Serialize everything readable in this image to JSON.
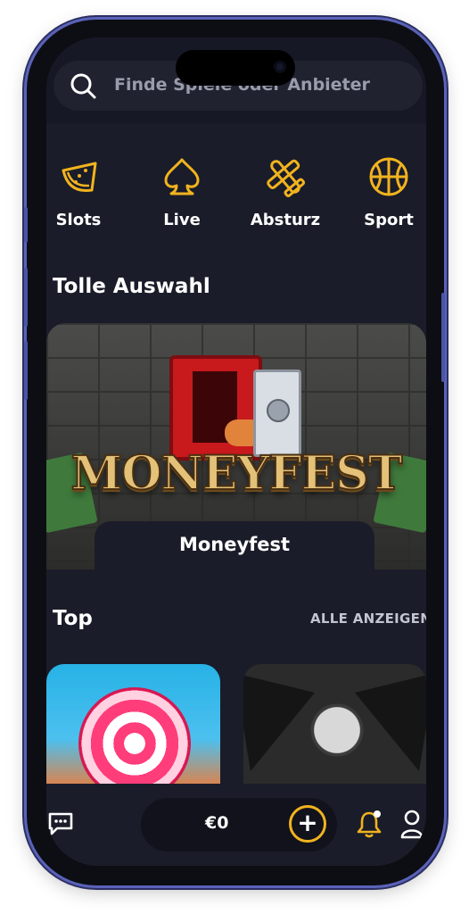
{
  "search": {
    "placeholder": "Finde Spiele oder Anbieter"
  },
  "categories": [
    {
      "label": "Slots",
      "icon": "watermelon-icon"
    },
    {
      "label": "Live",
      "icon": "spade-icon"
    },
    {
      "label": "Absturz",
      "icon": "airplane-icon"
    },
    {
      "label": "Sport",
      "icon": "basketball-icon"
    }
  ],
  "featured": {
    "title": "Tolle Auswahl",
    "game_logo_text": "MONEYFEST",
    "game_name": "Moneyfest"
  },
  "top": {
    "title": "Top",
    "view_all": "ALLE ANZEIGEN"
  },
  "bottom_nav": {
    "balance": "€0",
    "deposit_symbol": "+"
  },
  "colors": {
    "accent": "#F1B31E",
    "background": "#1A1C29",
    "frame": "#5A63B8"
  }
}
